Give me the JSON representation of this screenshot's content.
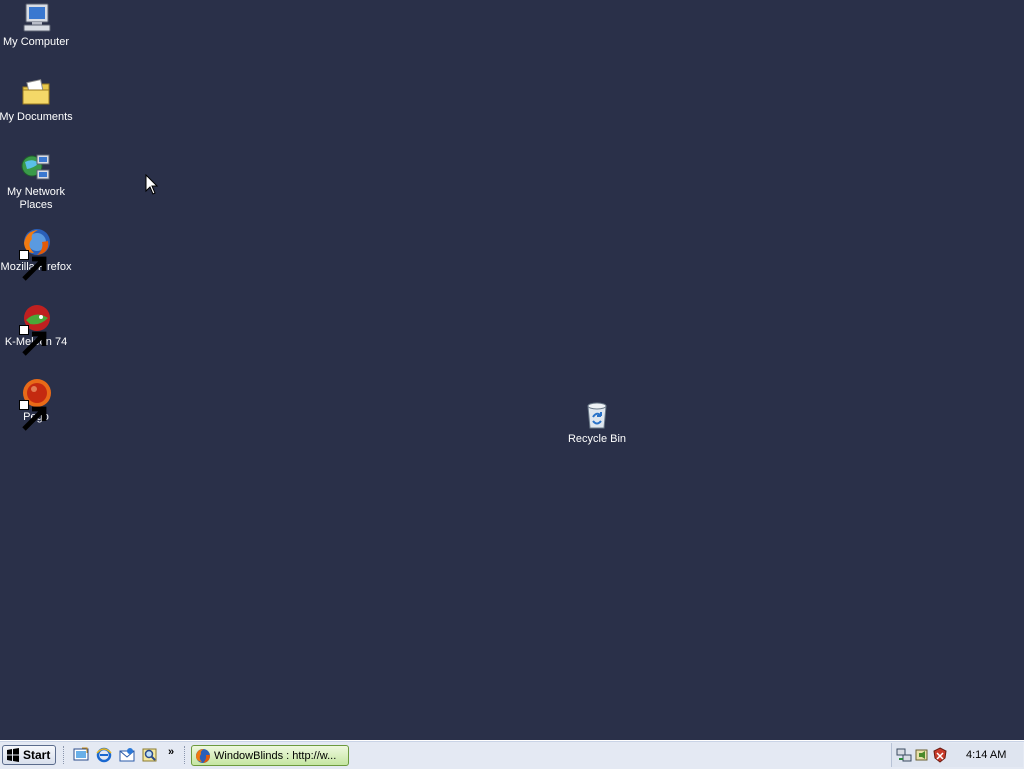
{
  "desktop": {
    "icons": [
      {
        "label": "My Computer"
      },
      {
        "label": "My Documents"
      },
      {
        "label": "My Network Places"
      },
      {
        "label": "Mozilla Firefox"
      },
      {
        "label": "K-Meleon 74"
      },
      {
        "label": "Pego"
      },
      {
        "label": "Recycle Bin"
      }
    ],
    "background_color": "#2a3049"
  },
  "taskbar": {
    "start_label": "Start",
    "quick_launch_more": "»",
    "task_button_label": "WindowBlinds : http://w...",
    "clock": "4:14 AM"
  }
}
